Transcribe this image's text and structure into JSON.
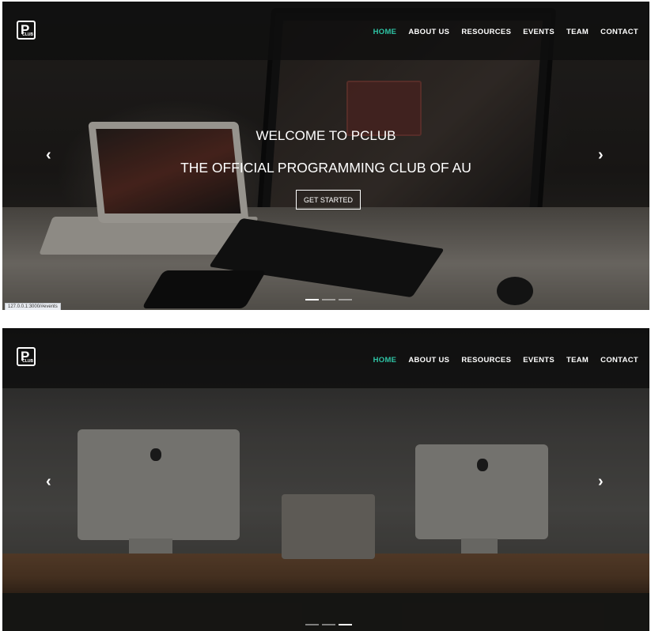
{
  "colors": {
    "accent": "#2ec4a5",
    "navbar_bg": "#0e0e0e",
    "text": "#ffffff"
  },
  "logo": {
    "letter": "P",
    "subtitle": "CLUB"
  },
  "nav": {
    "items": [
      {
        "label": "HOME",
        "active": true
      },
      {
        "label": "ABOUT US",
        "active": false
      },
      {
        "label": "RESOURCES",
        "active": false
      },
      {
        "label": "EVENTS",
        "active": false
      },
      {
        "label": "TEAM",
        "active": false
      },
      {
        "label": "CONTACT",
        "active": false
      }
    ]
  },
  "hero": {
    "title": "WELCOME TO PCLUB",
    "subtitle": "THE OFFICIAL PROGRAMMING CLUB OF AU",
    "cta_label": "GET STARTED"
  },
  "carousel": {
    "prev_icon": "chevron-left-icon",
    "next_icon": "chevron-right-icon",
    "prev_glyph": "‹",
    "next_glyph": "›",
    "slides": 3,
    "active_slide_shot1": 1,
    "active_slide_shot2": 3
  },
  "status_bar": {
    "url": "127.0.0.1:3000/#events"
  }
}
